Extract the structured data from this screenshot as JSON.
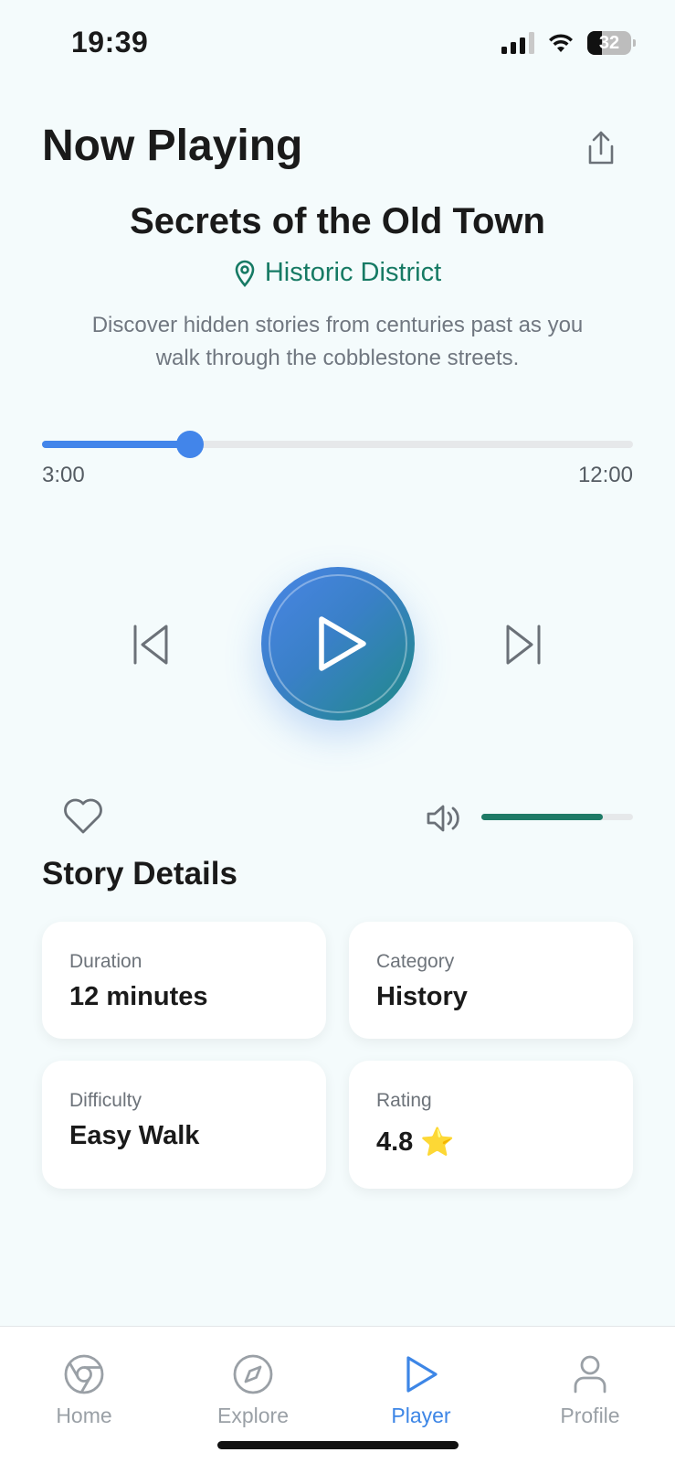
{
  "status_bar": {
    "time": "19:39",
    "battery": "32"
  },
  "header": {
    "title": "Now Playing",
    "share_icon": "share-icon"
  },
  "story": {
    "title": "Secrets of the Old Town",
    "location": "Historic District",
    "description": "Discover hidden stories from centuries past as you walk through the cobblestone streets."
  },
  "playback": {
    "current_time": "3:00",
    "total_time": "12:00",
    "progress": 0.25
  },
  "volume": {
    "level": 0.8
  },
  "details": {
    "heading": "Story Details",
    "cards": [
      {
        "label": "Duration",
        "value": "12 minutes"
      },
      {
        "label": "Category",
        "value": "History"
      },
      {
        "label": "Difficulty",
        "value": "Easy Walk"
      },
      {
        "label": "Rating",
        "value": "4.8",
        "icon": "⭐"
      }
    ]
  },
  "tabs": [
    {
      "label": "Home",
      "icon": "chrome-icon",
      "active": false
    },
    {
      "label": "Explore",
      "icon": "compass-icon",
      "active": false
    },
    {
      "label": "Player",
      "icon": "play-icon",
      "active": true
    },
    {
      "label": "Profile",
      "icon": "user-icon",
      "active": false
    }
  ],
  "colors": {
    "accent": "#4285ea",
    "green": "#1e7a66",
    "active_tab": "#3d86e6"
  }
}
